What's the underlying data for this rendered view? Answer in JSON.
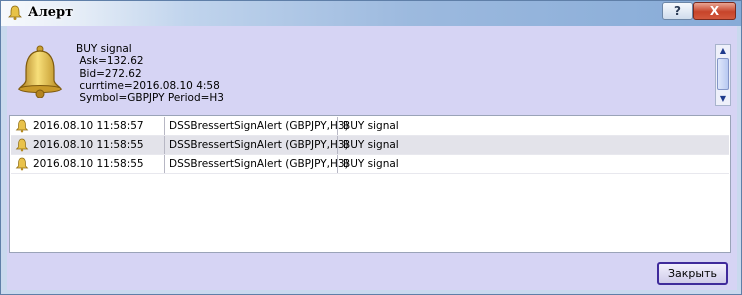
{
  "window": {
    "title": "Алерт",
    "help_label": "?",
    "close_label": "X"
  },
  "message": {
    "text": "BUY signal\n Ask=132.62\n Bid=272.62\n currtime=2016.08.10 4:58\n Symbol=GBPJPY Period=H3"
  },
  "alerts": [
    {
      "time": "2016.08.10 11:58:57",
      "expert": "DSSBressertSignAlert (GBPJPY,H3)",
      "message": "BUY signal"
    },
    {
      "time": "2016.08.10 11:58:55",
      "expert": "DSSBressertSignAlert (GBPJPY,H3)",
      "message": "BUY signal"
    },
    {
      "time": "2016.08.10 11:58:55",
      "expert": "DSSBressertSignAlert (GBPJPY,H3)",
      "message": "BUY signal"
    }
  ],
  "buttons": {
    "close": "Закрыть"
  },
  "icons": {
    "title": "bell-icon",
    "message": "bell-icon",
    "row": "bell-icon"
  },
  "colors": {
    "client_bg": "#d6d4f4",
    "selected_row": "#e3e3ea",
    "close_button_border": "#3f2a9b"
  }
}
